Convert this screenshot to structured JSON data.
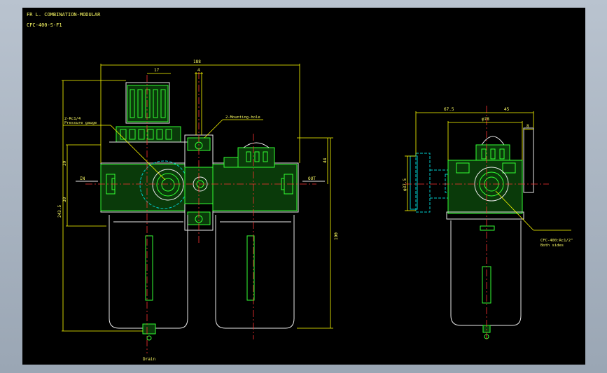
{
  "title": "FR L. COMBINATION-MODULAR",
  "model": "CFC-400-S-F1",
  "front_view": {
    "dim_overall_width": "188",
    "dim_top_17": "17",
    "dim_top_4": "4",
    "dim_left_39": "39",
    "dim_left_30": "30",
    "dim_height": "243.5",
    "dim_right_44": "44",
    "dim_right_190": "190",
    "label_gauge_port": "2-Rc1/4",
    "label_gauge": "Pressure gauge",
    "label_mounting": "2-Mounting-hole",
    "label_in": "IN",
    "label_out": "OUT",
    "label_drain": "Drain"
  },
  "side_view": {
    "dim_left": "67.5",
    "dim_right": "45",
    "dim_dia": "φ78",
    "dim_8": "8",
    "dim_gauge_dia": "φ37.5",
    "label_port": "CFC-400:Rc1/2\"",
    "label_port_note": "Both sides"
  },
  "colors": {
    "background": "#000000",
    "text": "#ffff66",
    "dimension": "#ffff00",
    "outline": "#33ff33",
    "body": "#e8e8e8",
    "centerline": "#ff3333",
    "hidden": "#00cccc"
  }
}
